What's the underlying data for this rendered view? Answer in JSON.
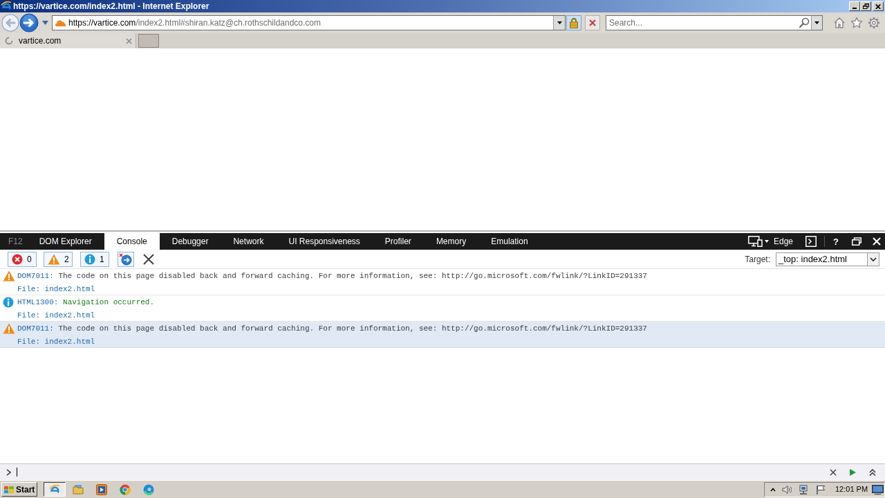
{
  "window": {
    "title": "https://vartice.com/index2.html - Internet Explorer"
  },
  "address_bar": {
    "host": "https://vartice.com",
    "path": "/index2.html#shiran.katz@ch.rothschildandco.com"
  },
  "search": {
    "placeholder": "Search..."
  },
  "browser_tabs": [
    {
      "label": "vartice.com",
      "selected": true,
      "loading": true
    }
  ],
  "devtools": {
    "label": "F12",
    "tabs": [
      {
        "label": "DOM Explorer",
        "selected": false
      },
      {
        "label": "Console",
        "selected": true
      },
      {
        "label": "Debugger",
        "selected": false
      },
      {
        "label": "Network",
        "selected": false
      },
      {
        "label": "UI Responsiveness",
        "selected": false
      },
      {
        "label": "Profiler",
        "selected": false
      },
      {
        "label": "Memory",
        "selected": false
      },
      {
        "label": "Emulation",
        "selected": false
      }
    ],
    "emulation_mode": "Edge",
    "help": "?",
    "filters": [
      {
        "kind": "error",
        "count": "0",
        "on": true
      },
      {
        "kind": "warning",
        "count": "2",
        "on": true
      },
      {
        "kind": "info",
        "count": "1",
        "on": true
      }
    ],
    "clear_on_navigate": {
      "on": true
    },
    "target": {
      "label": "Target:",
      "value": "_top: index2.html"
    },
    "messages": [
      {
        "kind": "warning",
        "code": "DOM7011:",
        "text": "The code on this page disabled back and forward caching. For more information, see: http://go.microsoft.com/fwlink/?LinkID=291337",
        "file": "File: index2.html",
        "selected": false
      },
      {
        "kind": "info",
        "code": "HTML1300:",
        "text": "Navigation occurred.",
        "file": "File: index2.html",
        "selected": false
      },
      {
        "kind": "warning",
        "code": "DOM7011:",
        "text": "The code on this page disabled back and forward caching. For more information, see: http://go.microsoft.com/fwlink/?LinkID=291337",
        "file": "File: index2.html",
        "selected": true
      }
    ]
  },
  "taskbar": {
    "start": "Start",
    "apps": [
      {
        "kind": "ie",
        "selected": true
      },
      {
        "kind": "folder",
        "selected": false
      },
      {
        "kind": "media",
        "selected": false
      },
      {
        "kind": "chrome",
        "selected": false
      },
      {
        "kind": "edge",
        "selected": false
      }
    ],
    "clock": "12:01 PM"
  }
}
